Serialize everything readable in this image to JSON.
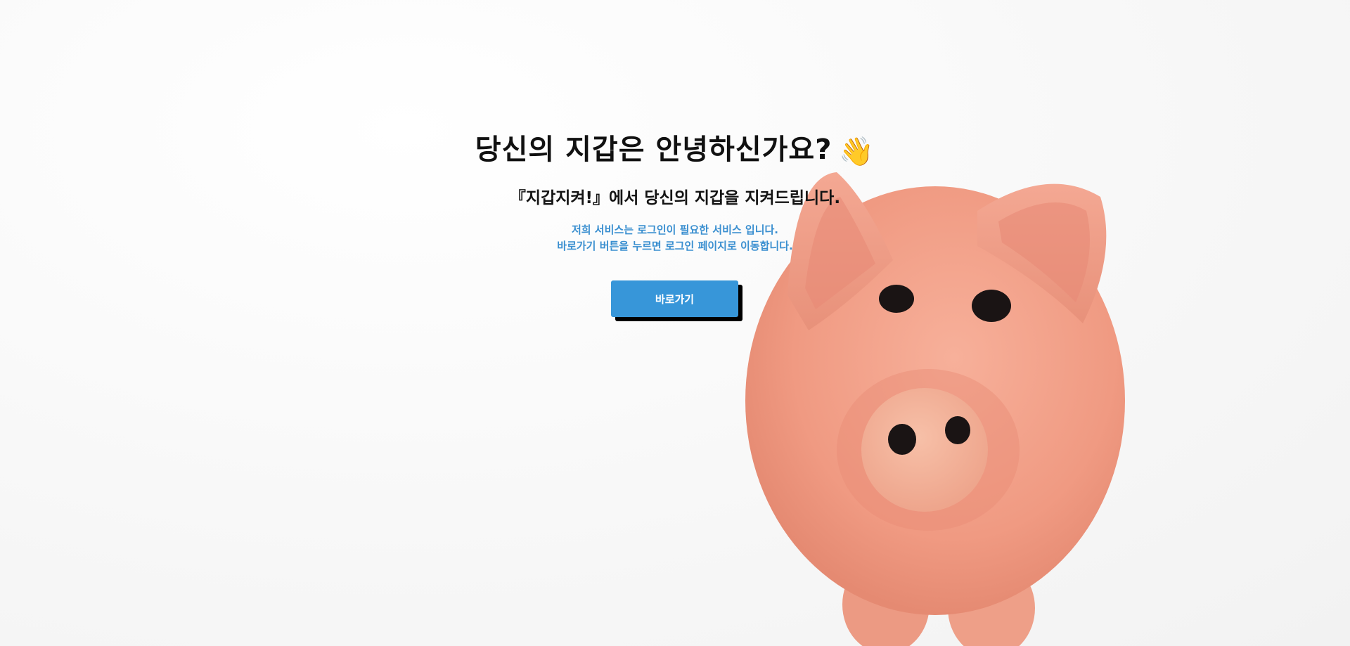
{
  "hero": {
    "title": "당신의 지갑은 안녕하신가요?",
    "title_emoji": "👋",
    "subtitle": "『지갑지켜!』에서 당신의 지갑을 지켜드립니다.",
    "description_line1": "저희 서비스는 로그인이 필요한 서비스 입니다.",
    "description_line2": "바로가기 버튼을 누르면 로그인 페이지로 이동합니다.",
    "button_label": "바로가기"
  },
  "colors": {
    "accent": "#3796d9",
    "description_text": "#3a8fd0",
    "title_text": "#111111",
    "pig_body": "#f3a08a"
  },
  "illustration": {
    "icon": "piggy-bank-image"
  }
}
